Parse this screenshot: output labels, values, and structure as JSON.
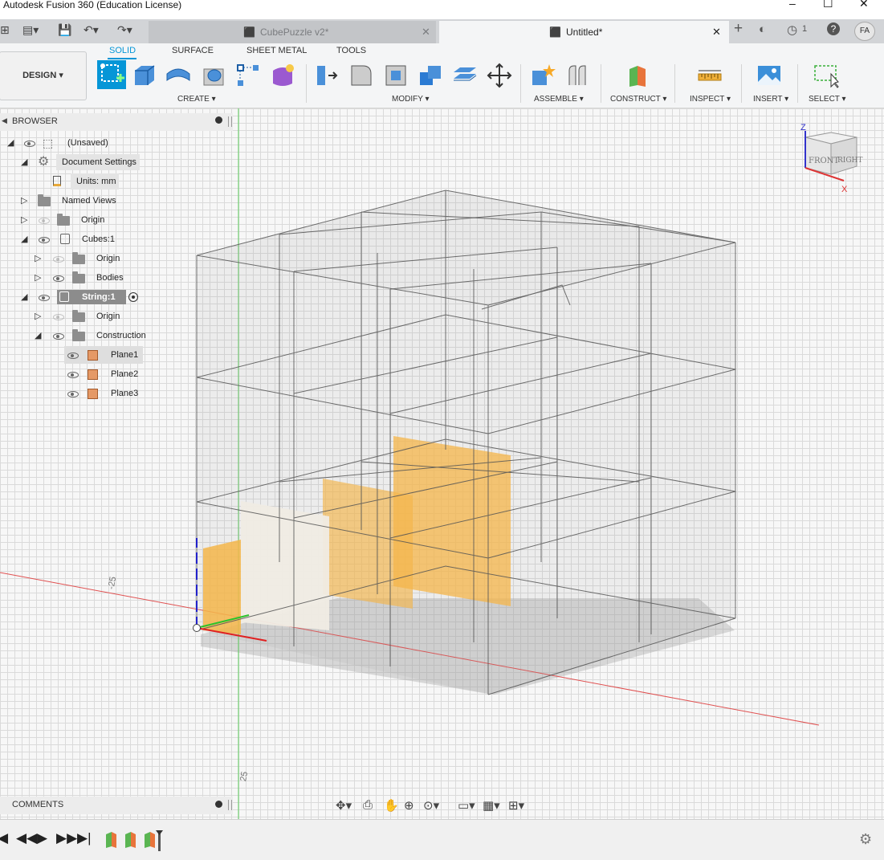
{
  "window": {
    "title": "Autodesk Fusion 360 (Education License)",
    "minimize": "–",
    "maximize": "☐",
    "close": "✕"
  },
  "tabs": [
    {
      "label": "CubePuzzle v2*",
      "close": "✕"
    },
    {
      "label": "Untitled*",
      "close": "✕"
    }
  ],
  "tabbar_right": {
    "add": "+",
    "jobs_count": "1",
    "help": "?",
    "user_initials": "FA"
  },
  "workspace": {
    "label": "DESIGN ▾"
  },
  "ribbon_tabs": [
    "SOLID",
    "SURFACE",
    "SHEET METAL",
    "TOOLS"
  ],
  "ribbon_groups": {
    "create": "CREATE ▾",
    "modify": "MODIFY ▾",
    "assemble": "ASSEMBLE ▾",
    "construct": "CONSTRUCT ▾",
    "inspect": "INSPECT ▾",
    "insert": "INSERT ▾",
    "select": "SELECT ▾"
  },
  "browser": {
    "title": "BROWSER",
    "items": [
      {
        "label": "(Unsaved)"
      },
      {
        "label": "Document Settings"
      },
      {
        "label": "Units: mm"
      },
      {
        "label": "Named Views"
      },
      {
        "label": "Origin"
      },
      {
        "label": "Cubes:1"
      },
      {
        "label": "Origin"
      },
      {
        "label": "Bodies"
      },
      {
        "label": "String:1"
      },
      {
        "label": "Origin"
      },
      {
        "label": "Construction"
      },
      {
        "label": "Plane1"
      },
      {
        "label": "Plane2"
      },
      {
        "label": "Plane3"
      }
    ]
  },
  "viewcube": {
    "front": "FRONT",
    "right": "RIGHT",
    "z": "Z",
    "x": "X"
  },
  "rulers": {
    "neg": "-25",
    "pos": "25"
  },
  "comments": {
    "title": "COMMENTS"
  },
  "colors": {
    "accent": "#0696d7",
    "plane": "#f5b64a",
    "x_axis": "#e03030",
    "y_axis": "#2cc22c",
    "z_axis": "#2222cc"
  }
}
